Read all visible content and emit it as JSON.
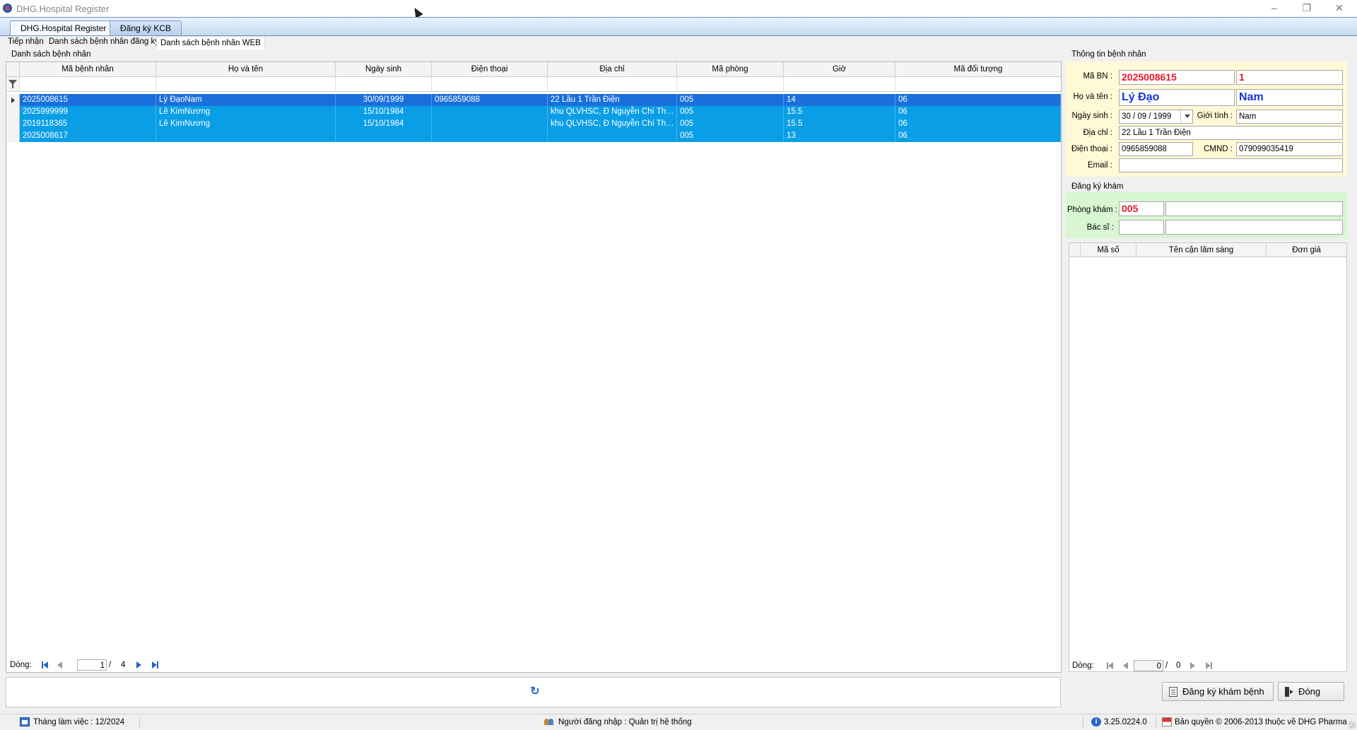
{
  "window": {
    "title": "DHG.Hospital Register"
  },
  "doc_tabs": [
    {
      "label": "DHG.Hospital Register"
    },
    {
      "label": "Đăng ký KCB"
    }
  ],
  "sub_tabs": [
    {
      "label": "Tiếp nhận"
    },
    {
      "label": "Danh sách bệnh nhân đăng ký"
    },
    {
      "label": "Danh sách bệnh nhân WEB"
    }
  ],
  "patient_list": {
    "title": "Danh sách bệnh nhân",
    "columns": [
      "Mã bệnh nhân",
      "Họ và tên",
      "Ngày sinh",
      "Điện thoại",
      "Địa chỉ",
      "Mã phòng",
      "Giờ",
      "Mã đối tượng"
    ],
    "rows": [
      [
        "2025008615",
        "Lý ĐạoNam",
        "30/09/1999",
        "0965859088",
        "22 Lầu 1 Trần Điện",
        "005",
        "14",
        "06"
      ],
      [
        "2025999999",
        "Lê KimNương",
        "15/10/1984",
        "",
        "khu QLVHSC, Đ Nguyễn Chí Thanh",
        "005",
        "15.5",
        "06"
      ],
      [
        "2019118365",
        "Lê KimNương",
        "15/10/1984",
        "",
        "khu QLVHSC, Đ Nguyễn Chí Thanh",
        "005",
        "15.5",
        "06"
      ],
      [
        "2025008617",
        "",
        "",
        "",
        "",
        "005",
        "13",
        "06"
      ]
    ],
    "pager": {
      "label": "Dòng:",
      "current": "1",
      "total": "4"
    }
  },
  "patient_info": {
    "title": "Thông tin bệnh nhân",
    "ma_bn_label": "Mã BN :",
    "ma_bn": "2025008615",
    "ma_bn_seq": "1",
    "ho_ten_label": "Họ và tên :",
    "ho_dem": "Lý Đạo",
    "ten": "Nam",
    "ngay_sinh_label": "Ngày sinh :",
    "ngay_sinh": "30 / 09 / 1999",
    "gioi_tinh_label": "Giới tính :",
    "gioi_tinh": "Nam",
    "dia_chi_label": "Địa chỉ :",
    "dia_chi": "22 Lầu 1 Trần Điện",
    "dien_thoai_label": "Điện thoại :",
    "dien_thoai": "0965859088",
    "cmnd_label": "CMND :",
    "cmnd": "079099035419",
    "email_label": "Email :",
    "email": ""
  },
  "registration": {
    "title": "Đăng ký khám",
    "phong_kham_label": "Phòng khám :",
    "phong_kham_code": "005",
    "phong_kham_name": "",
    "bac_si_label": "Bác sĩ :",
    "bac_si_code": "",
    "bac_si_name": ""
  },
  "cls_table": {
    "columns": [
      "Mã số",
      "Tên cận lâm sàng",
      "Đơn giá"
    ],
    "pager": {
      "label": "Dòng:",
      "current": "0",
      "total": "0"
    }
  },
  "buttons": {
    "register": "Đăng ký khám bệnh",
    "close": "Đóng"
  },
  "status": {
    "month": "Tháng làm việc : 12/2024",
    "user": "Người đăng nhập : Quản trị hệ thống",
    "version": "3.25.0224.0",
    "copyright": "Bản quyền © 2006-2013 thuộc về DHG Pharma"
  },
  "colors": {
    "selected_row": "#1b6fdc",
    "highlight_row": "#0a9ee6",
    "info_bg": "#fff9d6",
    "reg_bg": "#d9f6d2",
    "accent_red": "#e8192c",
    "accent_blue": "#1536d6"
  }
}
